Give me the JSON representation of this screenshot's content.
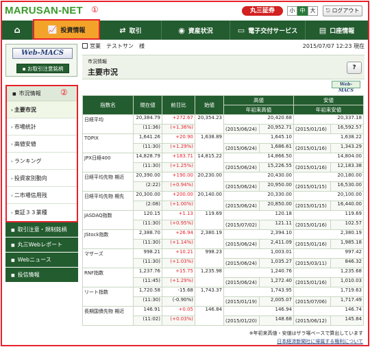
{
  "header": {
    "logo": "MARUSAN-NET",
    "annotation_1": "①",
    "brand": "丸三証券",
    "font_sizes": [
      "小",
      "中",
      "大"
    ],
    "logout": "ログアウト"
  },
  "nav": {
    "home_icon": "⌂",
    "items": [
      {
        "label": "投資情報",
        "icon": "chart-icon"
      },
      {
        "label": "取引",
        "icon": "arrows-icon"
      },
      {
        "label": "資産状況",
        "icon": "coins-icon"
      },
      {
        "label": "電子交付サービス",
        "icon": "monitor-icon"
      },
      {
        "label": "口座情報",
        "icon": "card-icon"
      }
    ]
  },
  "sidebar": {
    "webmacs": "Web-MACS",
    "stock_button": "お取引注意銘柄",
    "annotation_2": "②",
    "market_head": "市況情報",
    "market_items": [
      "主要市況",
      "市場統計",
      "高値安値",
      "ランキング",
      "投資家別動向",
      "二市場信用残",
      "東証３３業種"
    ],
    "sections": [
      "取引注意・規制銘柄",
      "丸三Webレポート",
      "Webニュース",
      "投信情報"
    ]
  },
  "info": {
    "user": "営業　テストサン　様",
    "datetime": "2015/07/07 12:23 現在"
  },
  "title": {
    "crumb": "市況情報",
    "heading": "主要市況",
    "help": "?",
    "webmacs": "Web-MACS"
  },
  "table": {
    "headers": {
      "name": "指数名",
      "price": "現在値",
      "change": "前日比",
      "open": "始値",
      "high": "高値",
      "low": "安値",
      "ytd_high": "年初来高値",
      "ytd_low": "年初来安値"
    },
    "rows": [
      {
        "name": "日経平均",
        "price": "20,384.79",
        "time": "(11:36)",
        "chg": "+272.67",
        "pct": "(+1.36%)",
        "dir": "pos",
        "open": "20,354.23",
        "high": "20,420.68",
        "low": "20,337.18",
        "yh_date": "(2015/06/24)",
        "yh": "20,952.71",
        "yl_date": "(2015/01/16)",
        "yl": "16,592.57"
      },
      {
        "name": "TOPIX",
        "price": "1,641.26",
        "time": "(11:30)",
        "chg": "+20.90",
        "pct": "(+1.29%)",
        "dir": "pos",
        "open": "1,638.89",
        "high": "1,645.10",
        "low": "1,638.22",
        "yh_date": "(2015/06/24)",
        "yh": "1,686.61",
        "yl_date": "(2015/01/16)",
        "yl": "1,343.29"
      },
      {
        "name": "JPX日経400",
        "price": "14,828.79",
        "time": "(11:30)",
        "chg": "+183.71",
        "pct": "(+1.25%)",
        "dir": "pos",
        "open": "14,815.22",
        "high": "14,866.50",
        "low": "14,804.00",
        "yh_date": "(2015/06/24)",
        "yh": "15,226.55",
        "yl_date": "(2015/01/16)",
        "yl": "12,183.38"
      },
      {
        "name": "日経平均先物 期近",
        "price": "20,390.00",
        "time": "(2:22)",
        "chg": "+190.00",
        "pct": "(+0.94%)",
        "dir": "pos",
        "open": "20,230.00",
        "high": "20,430.00",
        "low": "20,180.00",
        "yh_date": "(2015/06/24)",
        "yh": "20,950.00",
        "yl_date": "(2015/01/15)",
        "yl": "16,530.00"
      },
      {
        "name": "日経平均先物 期先",
        "price": "20,300.00",
        "time": "(2:08)",
        "chg": "+200.00",
        "pct": "(+1.00%)",
        "dir": "pos",
        "open": "20,140.00",
        "high": "20,330.00",
        "low": "20,100.00",
        "yh_date": "(2015/06/24)",
        "yh": "20,850.00",
        "yl_date": "(2015/01/15)",
        "yl": "16,440.00"
      },
      {
        "name": "JASDAQ指数",
        "price": "120.15",
        "time": "(11:30)",
        "chg": "+1.13",
        "pct": "(+0.95%)",
        "dir": "pos",
        "open": "119.69",
        "high": "120.18",
        "low": "119.69",
        "yh_date": "(2015/07/02)",
        "yh": "121.11",
        "yl_date": "(2015/01/16)",
        "yl": "102.57"
      },
      {
        "name": "JStock指数",
        "price": "2,388.70",
        "time": "(11:30)",
        "chg": "+26.94",
        "pct": "(+1.14%)",
        "dir": "pos",
        "open": "2,380.19",
        "high": "2,394.10",
        "low": "2,380.19",
        "yh_date": "(2015/06/24)",
        "yh": "2,411.09",
        "yl_date": "(2015/01/16)",
        "yl": "1,985.18"
      },
      {
        "name": "マザーズ",
        "price": "998.21",
        "time": "(11:30)",
        "chg": "+10.21",
        "pct": "(+1.03%)",
        "dir": "pos",
        "open": "998.23",
        "high": "1,003.01",
        "low": "997.42",
        "yh_date": "(2015/06/24)",
        "yh": "1,035.27",
        "yl_date": "(2015/03/11)",
        "yl": "846.32"
      },
      {
        "name": "RNF指数",
        "price": "1,237.76",
        "time": "(11:45)",
        "chg": "+15.75",
        "pct": "(+1.29%)",
        "dir": "pos",
        "open": "1,235.98",
        "high": "1,240.76",
        "low": "1,235.68",
        "yh_date": "(2015/06/24)",
        "yh": "1,272.40",
        "yl_date": "(2015/01/16)",
        "yl": "1,010.03"
      },
      {
        "name": "リート指数",
        "price": "1,720.58",
        "time": "(11:30)",
        "chg": "-15.68",
        "pct": "(-0.90%)",
        "dir": "neg",
        "open": "1,743.37",
        "high": "1,743.95",
        "low": "1,719.63",
        "yh_date": "(2015/01/19)",
        "yh": "2,005.07",
        "yl_date": "(2015/07/06)",
        "yl": "1,717.49"
      },
      {
        "name": "長期国債先物 期近",
        "price": "146.91",
        "time": "(11:02)",
        "chg": "+0.05",
        "pct": "(+0.03%)",
        "dir": "pos",
        "open": "146.84",
        "high": "146.94",
        "low": "146.74",
        "yh_date": "(2015/01/20)",
        "yh": "148.68",
        "yl_date": "(2015/06/12)",
        "yl": "145.84"
      }
    ]
  },
  "notes": {
    "note1": "※年初来高値・安値はザラ場ベースで算出しています",
    "note2": "日本経済新聞社に帰属する権利について"
  }
}
